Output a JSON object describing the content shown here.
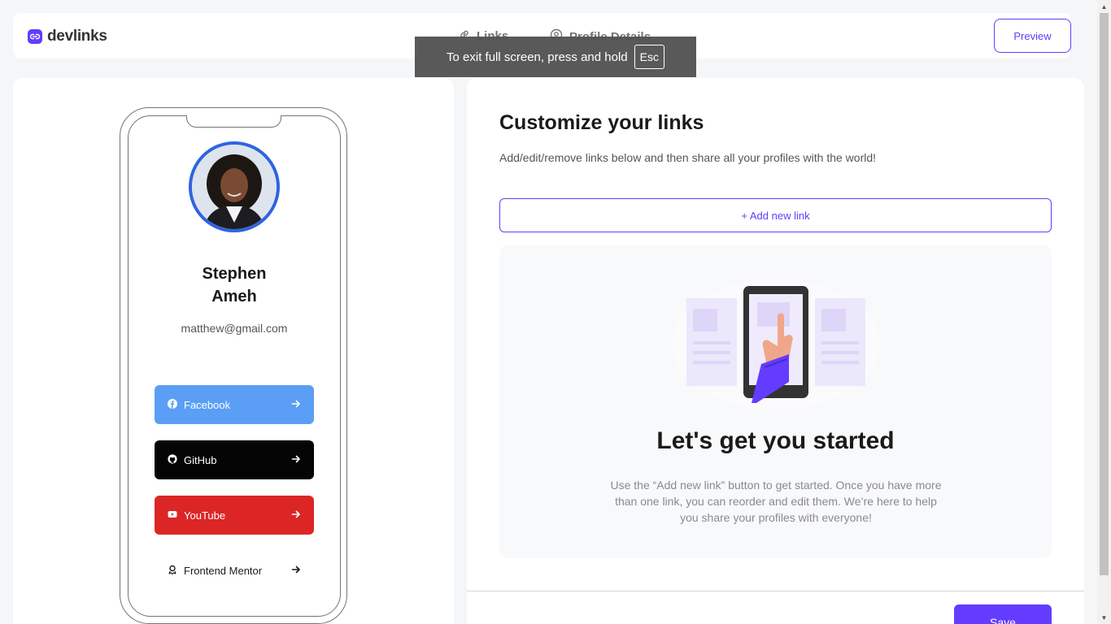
{
  "header": {
    "logo_text": "devlinks",
    "tabs": [
      {
        "label": "Links",
        "icon": "link-icon"
      },
      {
        "label": "Profile Details",
        "icon": "profile-icon"
      }
    ],
    "preview_label": "Preview"
  },
  "fullscreen_toast": {
    "text": "To exit full screen, press and hold",
    "key": "Esc"
  },
  "phone_preview": {
    "name_line1": "Stephen",
    "name_line2": "Ameh",
    "email": "matthew@gmail.com",
    "links": [
      {
        "platform": "Facebook",
        "icon": "facebook-icon",
        "color": "#5a9ff5"
      },
      {
        "platform": "GitHub",
        "icon": "github-icon",
        "color": "#050505"
      },
      {
        "platform": "YouTube",
        "icon": "youtube-icon",
        "color": "#dc2626"
      },
      {
        "platform": "Frontend Mentor",
        "icon": "frontend-mentor-icon",
        "color": "#ffffff"
      }
    ]
  },
  "editor": {
    "title": "Customize your links",
    "subtitle": "Add/edit/remove links below and then share all your profiles with the world!",
    "add_link_label": "+ Add new link",
    "empty_title": "Let's get you started",
    "empty_description": "Use the “Add new link” button to get started. Once you have more than one link, you can reorder and edit them. We’re here to help you share your profiles with everyone!",
    "save_label": "Save"
  },
  "colors": {
    "accent": "#633cff",
    "avatar_ring": "#2f63e0"
  }
}
